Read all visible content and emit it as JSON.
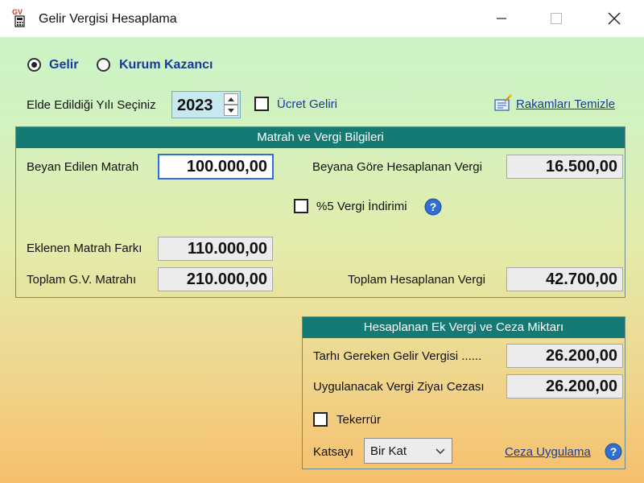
{
  "window": {
    "title": "Gelir Vergisi Hesaplama",
    "icon_text": "GV",
    "icons": {
      "app": "calculator-icon",
      "minimize": "minimize-icon",
      "maximize": "maximize-icon",
      "close": "close-icon"
    }
  },
  "mode": {
    "options": [
      {
        "label": "Gelir",
        "selected": true
      },
      {
        "label": "Kurum Kazancı",
        "selected": false
      }
    ]
  },
  "year": {
    "label": "Elde Edildiği Yılı Seçiniz",
    "value": "2023"
  },
  "wage_income": {
    "label": "Ücret Geliri",
    "checked": false
  },
  "clear_link": {
    "label": "Rakamları Temizle",
    "icon": "erase-icon"
  },
  "matrah_group": {
    "title": "Matrah ve Vergi Bilgileri",
    "declared_base_label": "Beyan Edilen Matrah",
    "declared_base_value": "100.000,00",
    "declared_tax_label": "Beyana Göre Hesaplanan Vergi",
    "declared_tax_value": "16.500,00",
    "discount_label": "%5 Vergi İndirimi",
    "discount_checked": false,
    "added_base_label": "Eklenen Matrah Farkı",
    "added_base_value": "110.000,00",
    "total_base_label": "Toplam G.V. Matrahı",
    "total_base_value": "210.000,00",
    "total_tax_label": "Toplam Hesaplanan Vergi",
    "total_tax_value": "42.700,00"
  },
  "penalty_group": {
    "title": "Hesaplanan Ek Vergi ve Ceza Miktarı",
    "assess_label": "Tarhı Gereken Gelir Vergisi ......",
    "assess_value": "26.200,00",
    "penalty_label": "Uygulanacak Vergi Ziyaı Cezası",
    "penalty_value": "26.200,00",
    "repeat_label": "Tekerrür",
    "repeat_checked": false,
    "coef_label": "Katsayı",
    "coef_value": "Bir Kat",
    "apply_link": "Ceza Uygulama"
  },
  "colors": {
    "accent_header": "#157a74",
    "link": "#1a3a9a",
    "focus_border": "#2d6fd6"
  }
}
